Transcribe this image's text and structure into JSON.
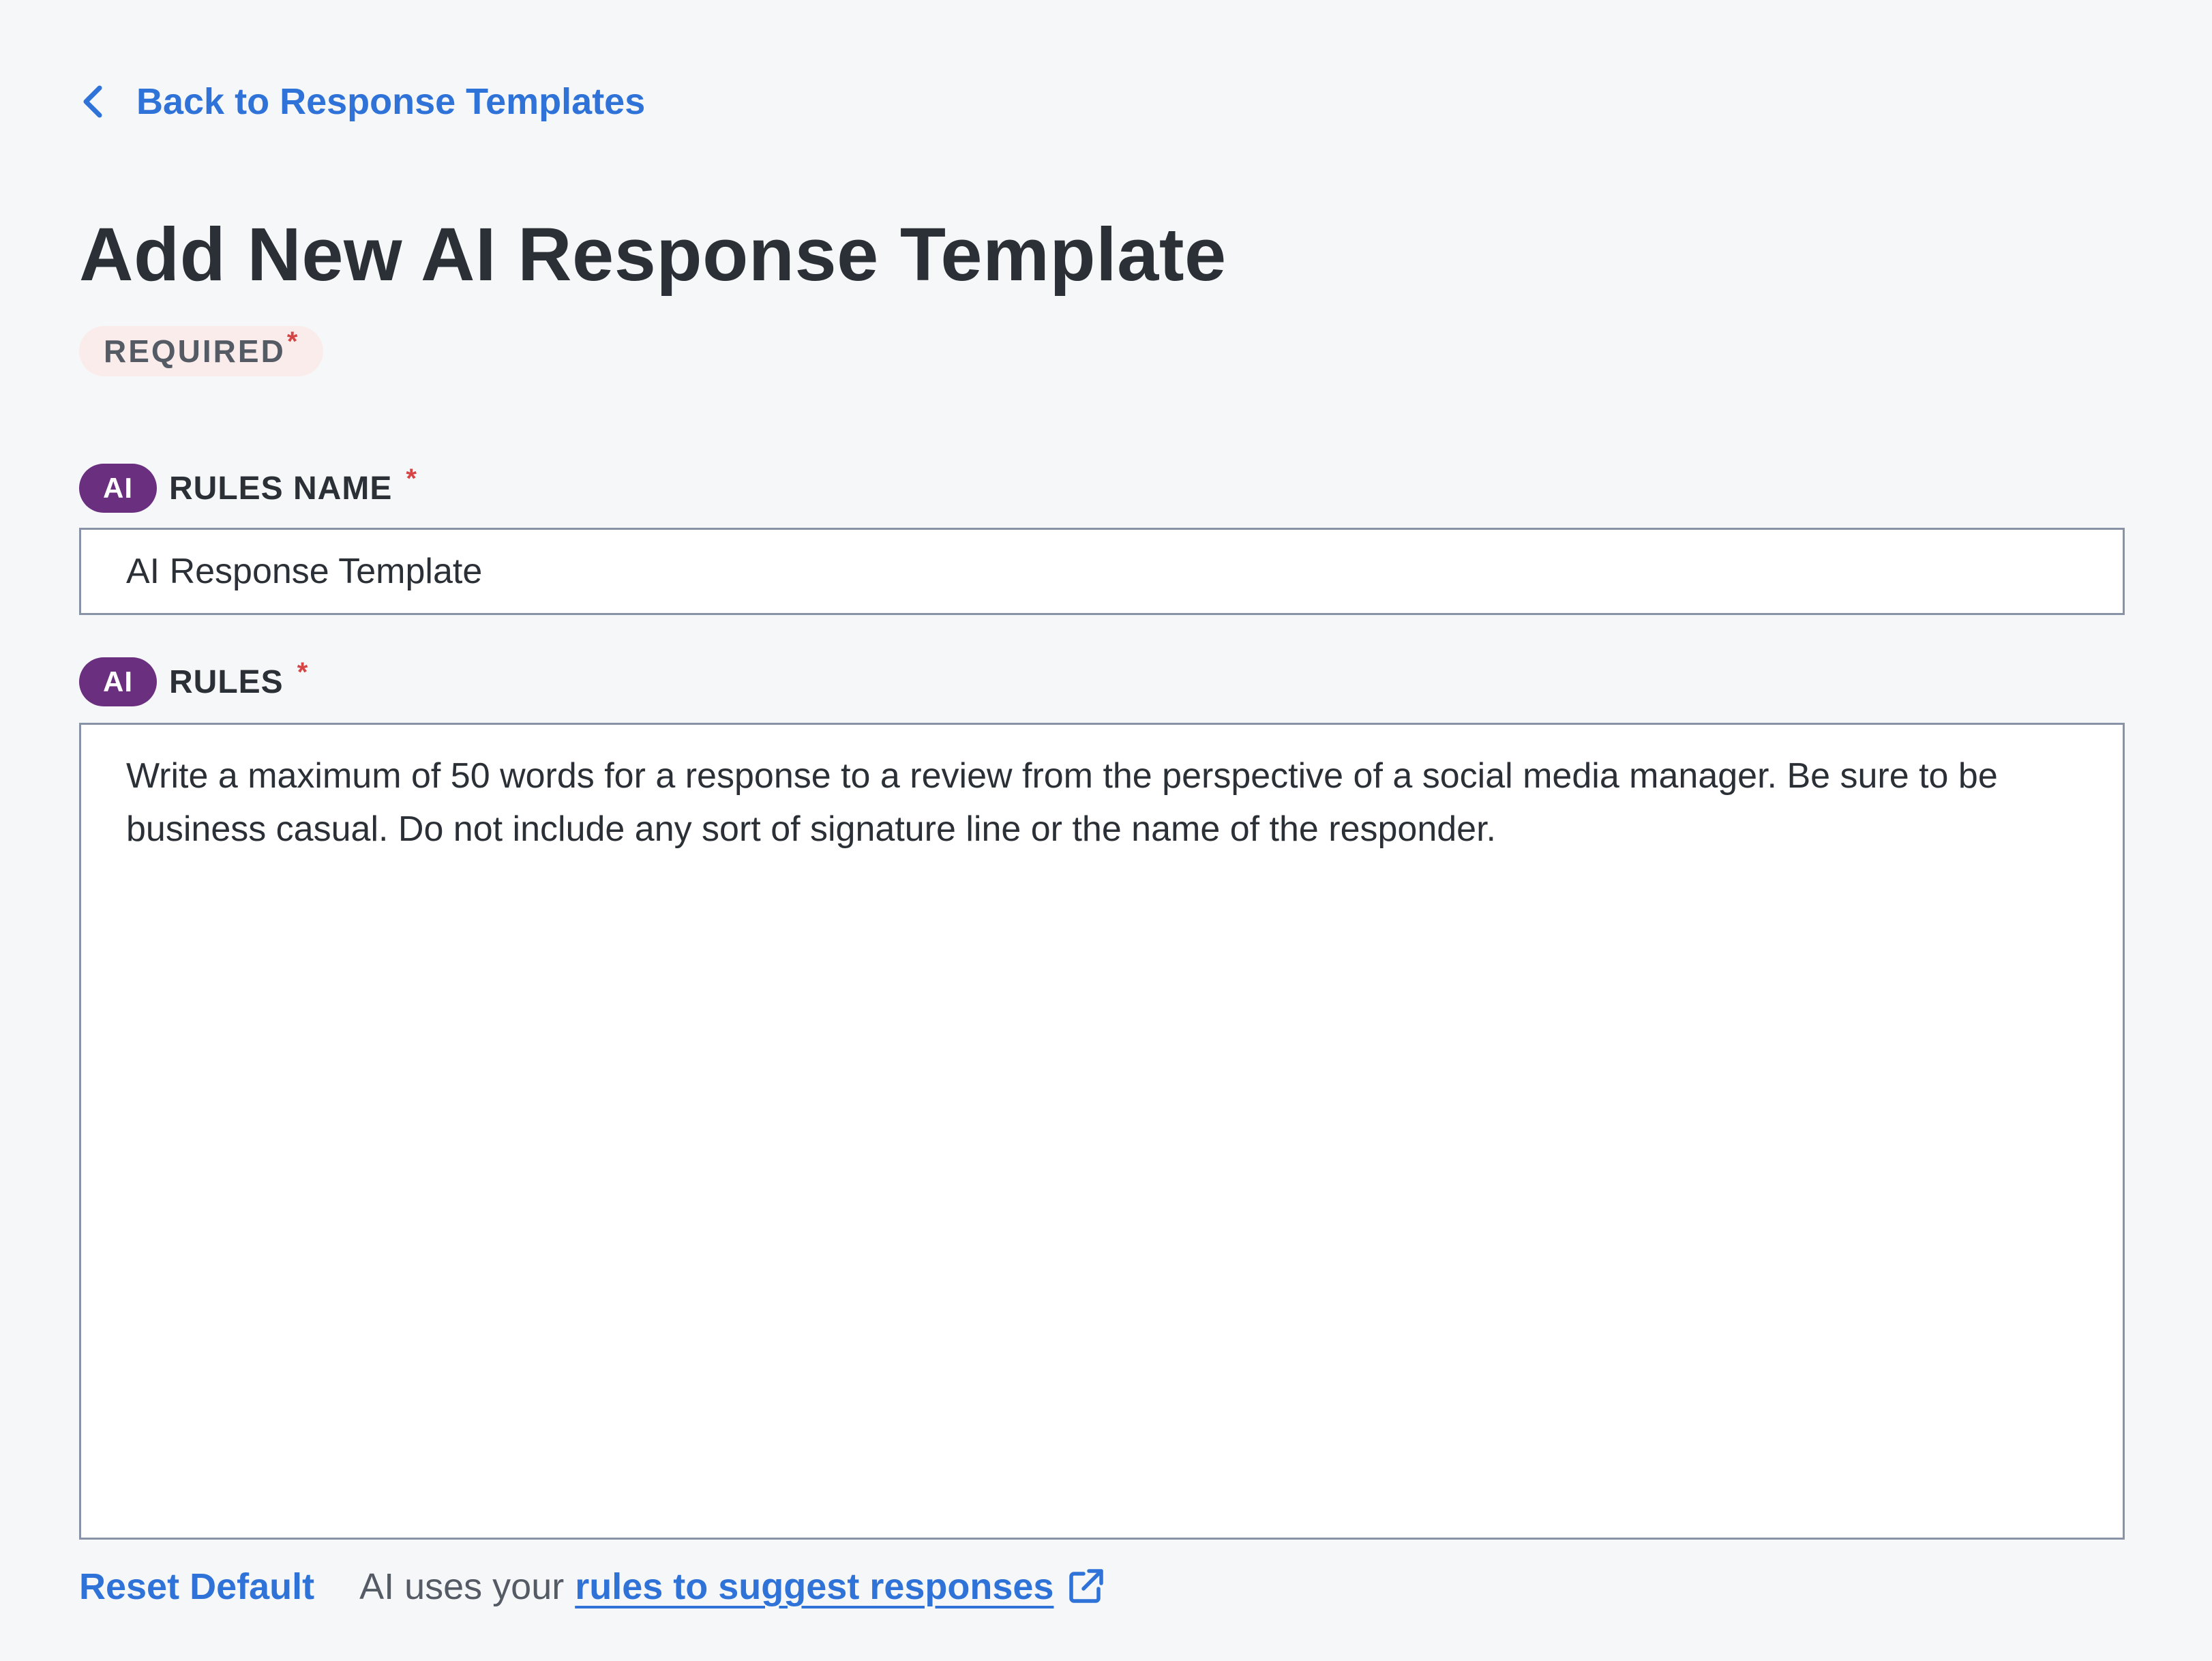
{
  "nav": {
    "back_label": "Back to Response Templates",
    "back_icon": "chevron-left-icon"
  },
  "page": {
    "title": "Add New AI Response Template",
    "required_label": "REQUIRED",
    "required_star": "*"
  },
  "fields": {
    "rules_name": {
      "badge": "AI",
      "label": "RULES NAME",
      "star": "*",
      "value": "AI Response Template"
    },
    "rules": {
      "badge": "AI",
      "label": "RULES",
      "star": "*",
      "value": "Write a maximum of 50 words for a response to a review from the perspective of a social media manager. Be sure to be business casual. Do not include any sort of signature line or the name of the responder."
    }
  },
  "footer": {
    "reset_label": "Reset Default",
    "helper_text": "AI uses your",
    "link_text": "rules to suggest responses",
    "link_icon": "external-link-icon"
  },
  "colors": {
    "background": "#f6f7f9",
    "link": "#2f73d9",
    "ai_badge": "#6a2f7f",
    "required_bg": "#fbecec",
    "required_star": "#d64545",
    "input_border": "#8893a8",
    "text": "#2b2f36"
  }
}
